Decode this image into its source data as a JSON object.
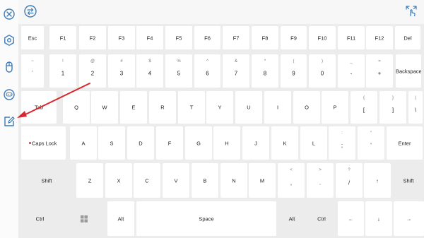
{
  "colors": {
    "icon_blue": "#3d7ab8",
    "key_bg": "#ffffff",
    "modifier_bg": "#ececec",
    "keyboard_bg": "#ececec",
    "annotation": "#d9262f"
  },
  "sidebar": {
    "items": [
      {
        "name": "close-icon"
      },
      {
        "name": "settings-icon"
      },
      {
        "name": "mouse-icon"
      },
      {
        "name": "gamepad-icon"
      },
      {
        "name": "edit-icon"
      }
    ]
  },
  "topbar": {
    "left_icon": "swap-icon",
    "right_icon": "touch-icon"
  },
  "keyboard": {
    "rows": [
      [
        {
          "label": "Esc"
        },
        {
          "label": "F1"
        },
        {
          "label": "F2"
        },
        {
          "label": "F3"
        },
        {
          "label": "F4"
        },
        {
          "label": "F5"
        },
        {
          "label": "F6"
        },
        {
          "label": "F7"
        },
        {
          "label": "F8"
        },
        {
          "label": "F9"
        },
        {
          "label": "F10"
        },
        {
          "label": "F11"
        },
        {
          "label": "F12"
        },
        {
          "label": "Del"
        }
      ],
      [
        {
          "label": "`",
          "shift": "~"
        },
        {
          "label": "1",
          "shift": "!"
        },
        {
          "label": "2",
          "shift": "@"
        },
        {
          "label": "3",
          "shift": "#"
        },
        {
          "label": "4",
          "shift": "$"
        },
        {
          "label": "5",
          "shift": "%"
        },
        {
          "label": "6",
          "shift": "^"
        },
        {
          "label": "7",
          "shift": "&"
        },
        {
          "label": "8",
          "shift": "*"
        },
        {
          "label": "9",
          "shift": "("
        },
        {
          "label": "0",
          "shift": ")"
        },
        {
          "label": "-",
          "shift": "_"
        },
        {
          "label": "+",
          "shift": "="
        },
        {
          "label": "Backspace"
        }
      ],
      [
        {
          "label": "Tab"
        },
        {
          "label": "Q"
        },
        {
          "label": "W"
        },
        {
          "label": "E"
        },
        {
          "label": "R"
        },
        {
          "label": "T"
        },
        {
          "label": "Y"
        },
        {
          "label": "U"
        },
        {
          "label": "I"
        },
        {
          "label": "O"
        },
        {
          "label": "P"
        },
        {
          "label": "[",
          "shift": "{"
        },
        {
          "label": "]",
          "shift": "}"
        },
        {
          "label": "\\",
          "shift": "|"
        }
      ],
      [
        {
          "label": "Caps Lock"
        },
        {
          "label": "A"
        },
        {
          "label": "S"
        },
        {
          "label": "D"
        },
        {
          "label": "F"
        },
        {
          "label": "G"
        },
        {
          "label": "H"
        },
        {
          "label": "J"
        },
        {
          "label": "K"
        },
        {
          "label": "L"
        },
        {
          "label": ";",
          "shift": ":"
        },
        {
          "label": "'",
          "shift": "\""
        },
        {
          "label": "Enter"
        }
      ],
      [
        {
          "label": "Shift"
        },
        {
          "label": "Z"
        },
        {
          "label": "X"
        },
        {
          "label": "C"
        },
        {
          "label": "V"
        },
        {
          "label": "B"
        },
        {
          "label": "N"
        },
        {
          "label": "M"
        },
        {
          "label": ",",
          "shift": "<"
        },
        {
          "label": ".",
          "shift": ">"
        },
        {
          "label": "/",
          "shift": "?"
        },
        {
          "label": "↑"
        },
        {
          "label": "Shift"
        }
      ],
      [
        {
          "label": "Ctrl"
        },
        {
          "label": "",
          "icon": "windows-icon"
        },
        {
          "label": "Alt"
        },
        {
          "label": "Space"
        },
        {
          "label": "Alt"
        },
        {
          "label": "Ctrl"
        },
        {
          "label": "←"
        },
        {
          "label": "↓"
        },
        {
          "label": "→"
        }
      ]
    ]
  }
}
